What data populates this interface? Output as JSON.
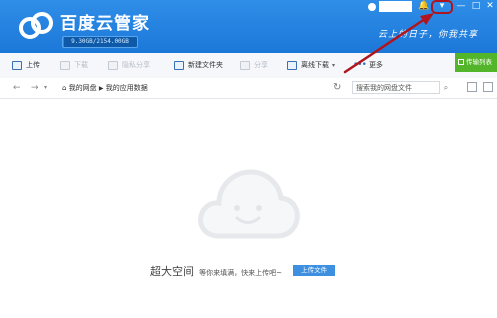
{
  "app": {
    "title": "百度云管家",
    "quota": "9.30GB/2154.00GB",
    "quota_used_fraction": 0.0043,
    "slogan": "云上的日子，你我共享"
  },
  "window_controls": [
    {
      "icon": "chevron-down-icon",
      "glyph": "▾"
    },
    {
      "icon": "minimize-icon",
      "glyph": "—"
    },
    {
      "icon": "maximize-icon",
      "glyph": "□"
    },
    {
      "icon": "close-icon",
      "glyph": "✕"
    }
  ],
  "toolbar": {
    "upload": "上传",
    "download": "下载",
    "share": "隐私分享",
    "new_folder": "新建文件夹",
    "delete": "分享",
    "offline_download": "离线下载",
    "more": "更多",
    "transfer_list": "传输列表"
  },
  "addressbar": {
    "back_glyph": "←",
    "forward_glyph": "→",
    "home_glyph": "⌂",
    "crumbs": [
      "我的网盘",
      "我的应用数据"
    ],
    "search_placeholder": "搜索我的网盘文件",
    "refresh_glyph": "↻",
    "search_glyph": "⌕"
  },
  "empty_state": {
    "headline": "超大空间",
    "subtext": "等你来填满，快来上传吧~",
    "upload_button": "上传文件"
  },
  "colors": {
    "header_blue": "#1c78d8",
    "accent_green": "#52b52a",
    "annotation_red": "#b0141e"
  }
}
